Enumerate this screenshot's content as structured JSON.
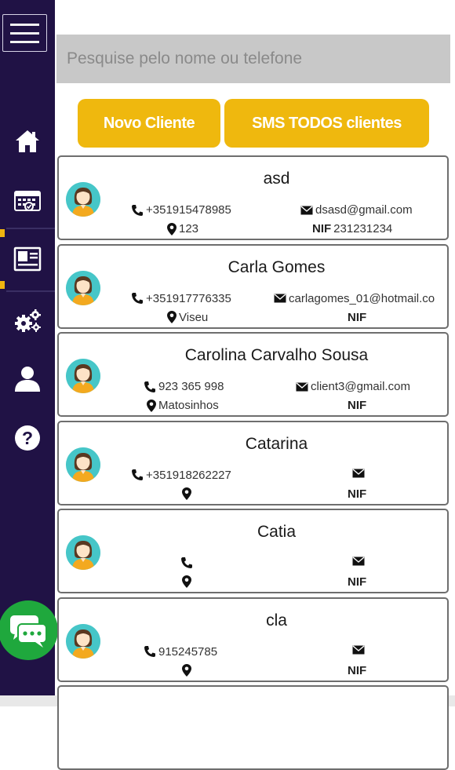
{
  "search": {
    "placeholder": "Pesquise pelo nome ou telefone"
  },
  "buttons": {
    "new_client": "Novo Cliente",
    "sms_all": "SMS TODOS clientes"
  },
  "nif_label": "NIF",
  "colors": {
    "sidebar": "#201245",
    "accent": "#efb80e",
    "chat": "#1fa83d",
    "avatar_bg": "#46c6c8"
  },
  "sidebar": {
    "items": [
      {
        "icon": "home-icon"
      },
      {
        "icon": "calendar-icon"
      },
      {
        "icon": "contact-card-icon",
        "active": true
      },
      {
        "icon": "gears-icon"
      },
      {
        "icon": "user-icon"
      },
      {
        "icon": "help-icon"
      }
    ],
    "chat_icon": "chat-icon"
  },
  "clients": [
    {
      "name": "asd",
      "phone": "+351915478985",
      "email": "dsasd@gmail.com",
      "location": "123",
      "nif": "231231234"
    },
    {
      "name": "Carla Gomes",
      "phone": "+351917776335",
      "email": "carlagomes_01@hotmail.co",
      "location": "Viseu",
      "nif": ""
    },
    {
      "name": "Carolina Carvalho Sousa",
      "phone": "923 365 998",
      "email": "client3@gmail.com",
      "location": "Matosinhos",
      "nif": ""
    },
    {
      "name": "Catarina",
      "phone": "+351918262227",
      "email": "",
      "location": "",
      "nif": ""
    },
    {
      "name": "Catia",
      "phone": "",
      "email": "",
      "location": "",
      "nif": ""
    },
    {
      "name": "cla",
      "phone": "915245785",
      "email": "",
      "location": "",
      "nif": ""
    }
  ]
}
